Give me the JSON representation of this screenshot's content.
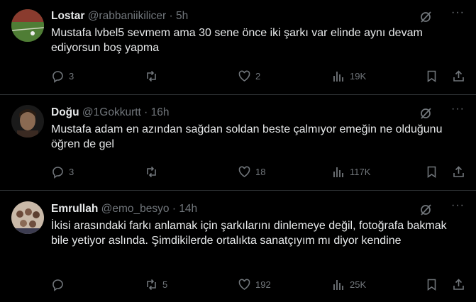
{
  "tweets": [
    {
      "name": "Lostar",
      "handle": "@rabbaniikilicer",
      "dot": "·",
      "time": "5h",
      "text": "Mustafa lvbel5 sevmem ama 30 sene önce iki şarkı var elinde aynı devam ediyorsun boş yapma",
      "replies": "3",
      "retweets": "",
      "likes": "2",
      "views": "19K"
    },
    {
      "name": "Doğu",
      "handle": "@1Gokkurtt",
      "dot": "·",
      "time": "16h",
      "text": "Mustafa adam en azından sağdan soldan beste çalmıyor emeğin ne olduğunu öğren de gel",
      "replies": "3",
      "retweets": "",
      "likes": "18",
      "views": "117K"
    },
    {
      "name": "Emrullah",
      "handle": "@emo_besyo",
      "dot": "·",
      "time": "14h",
      "text": "İkisi arasındaki farkı anlamak için şarkılarını dinlemeye değil, fotoğrafa bakmak bile yetiyor aslında. Şimdikilerde ortalıkta sanatçıyım mı diyor kendine",
      "replies": "",
      "retweets": "5",
      "likes": "192",
      "views": "25K"
    }
  ],
  "colors": {
    "background": "#000000",
    "text": "#e7e9ea",
    "muted": "#71767b",
    "divider": "#2f3336"
  },
  "icons": [
    "grok-icon",
    "more-icon",
    "reply-icon",
    "retweet-icon",
    "like-icon",
    "views-icon",
    "bookmark-icon",
    "share-icon"
  ]
}
